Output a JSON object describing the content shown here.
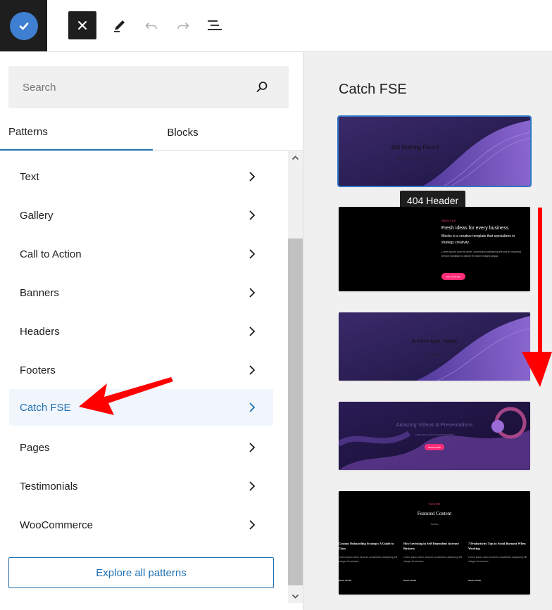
{
  "toolbar": {
    "close_label": "×",
    "icons": [
      "check-icon",
      "close-icon",
      "pencil-icon",
      "undo-icon",
      "redo-icon",
      "list-view-icon"
    ]
  },
  "search": {
    "placeholder": "Search"
  },
  "tabs": [
    {
      "label": "Patterns",
      "active": true
    },
    {
      "label": "Blocks",
      "active": false
    }
  ],
  "categories": [
    {
      "label": "Text"
    },
    {
      "label": "Gallery"
    },
    {
      "label": "Call to Action"
    },
    {
      "label": "Banners"
    },
    {
      "label": "Headers"
    },
    {
      "label": "Footers"
    },
    {
      "label": "Catch FSE",
      "selected": true
    },
    {
      "label": "Pages"
    },
    {
      "label": "Testimonials"
    },
    {
      "label": "WooCommerce"
    }
  ],
  "explore_label": "Explore all patterns",
  "preview": {
    "title": "Catch FSE",
    "tooltip": "404 Header",
    "cards": [
      {
        "heading": "404 Nothing Found",
        "sub": "Sorry! this page could be found"
      },
      {
        "kicker": "ABOUT US",
        "heading": "Fresh ideas for every business",
        "sub": "Blocks is a creative template that specializes in strategy creativity.",
        "body": "Lorem ipsum dolor sit amet, consectetur adipiscing elit sed do eiusmod tempor incididunt ut labore et dolore magna aliqua.",
        "button": "GET STARTED"
      },
      {
        "heading": "Archive type: Name",
        "sub": "Posts description"
      },
      {
        "heading": "Amazing Videos & Presentations",
        "sub": "Lorem ipsum dolor sit amet consectetur",
        "button": "READ MORE"
      },
      {
        "kicker": "TAGLINE",
        "heading": "Featured Content",
        "sub": "Subtitle",
        "columns": [
          {
            "title": "Custom Onboarding Strategy: A Guide to Class",
            "body": "Lorem ipsum dolor sit amet consectetur adipiscing elit integer fermentum.",
            "link": "READ MORE"
          },
          {
            "title": "How Investing in Self-Dependent Increase Business",
            "body": "Lorem ipsum dolor sit amet consectetur adipiscing elit integer fermentum.",
            "link": "READ MORE"
          },
          {
            "title": "7 Productivity Tips to Avoid Burnout When Working",
            "body": "Lorem ipsum dolor sit amet consectetur adipiscing elit integer fermentum.",
            "link": "READ MORE"
          }
        ]
      }
    ]
  },
  "colors": {
    "accent": "#2271b1",
    "annotation": "#ff0000",
    "site_icon": "#3f7fd1"
  }
}
